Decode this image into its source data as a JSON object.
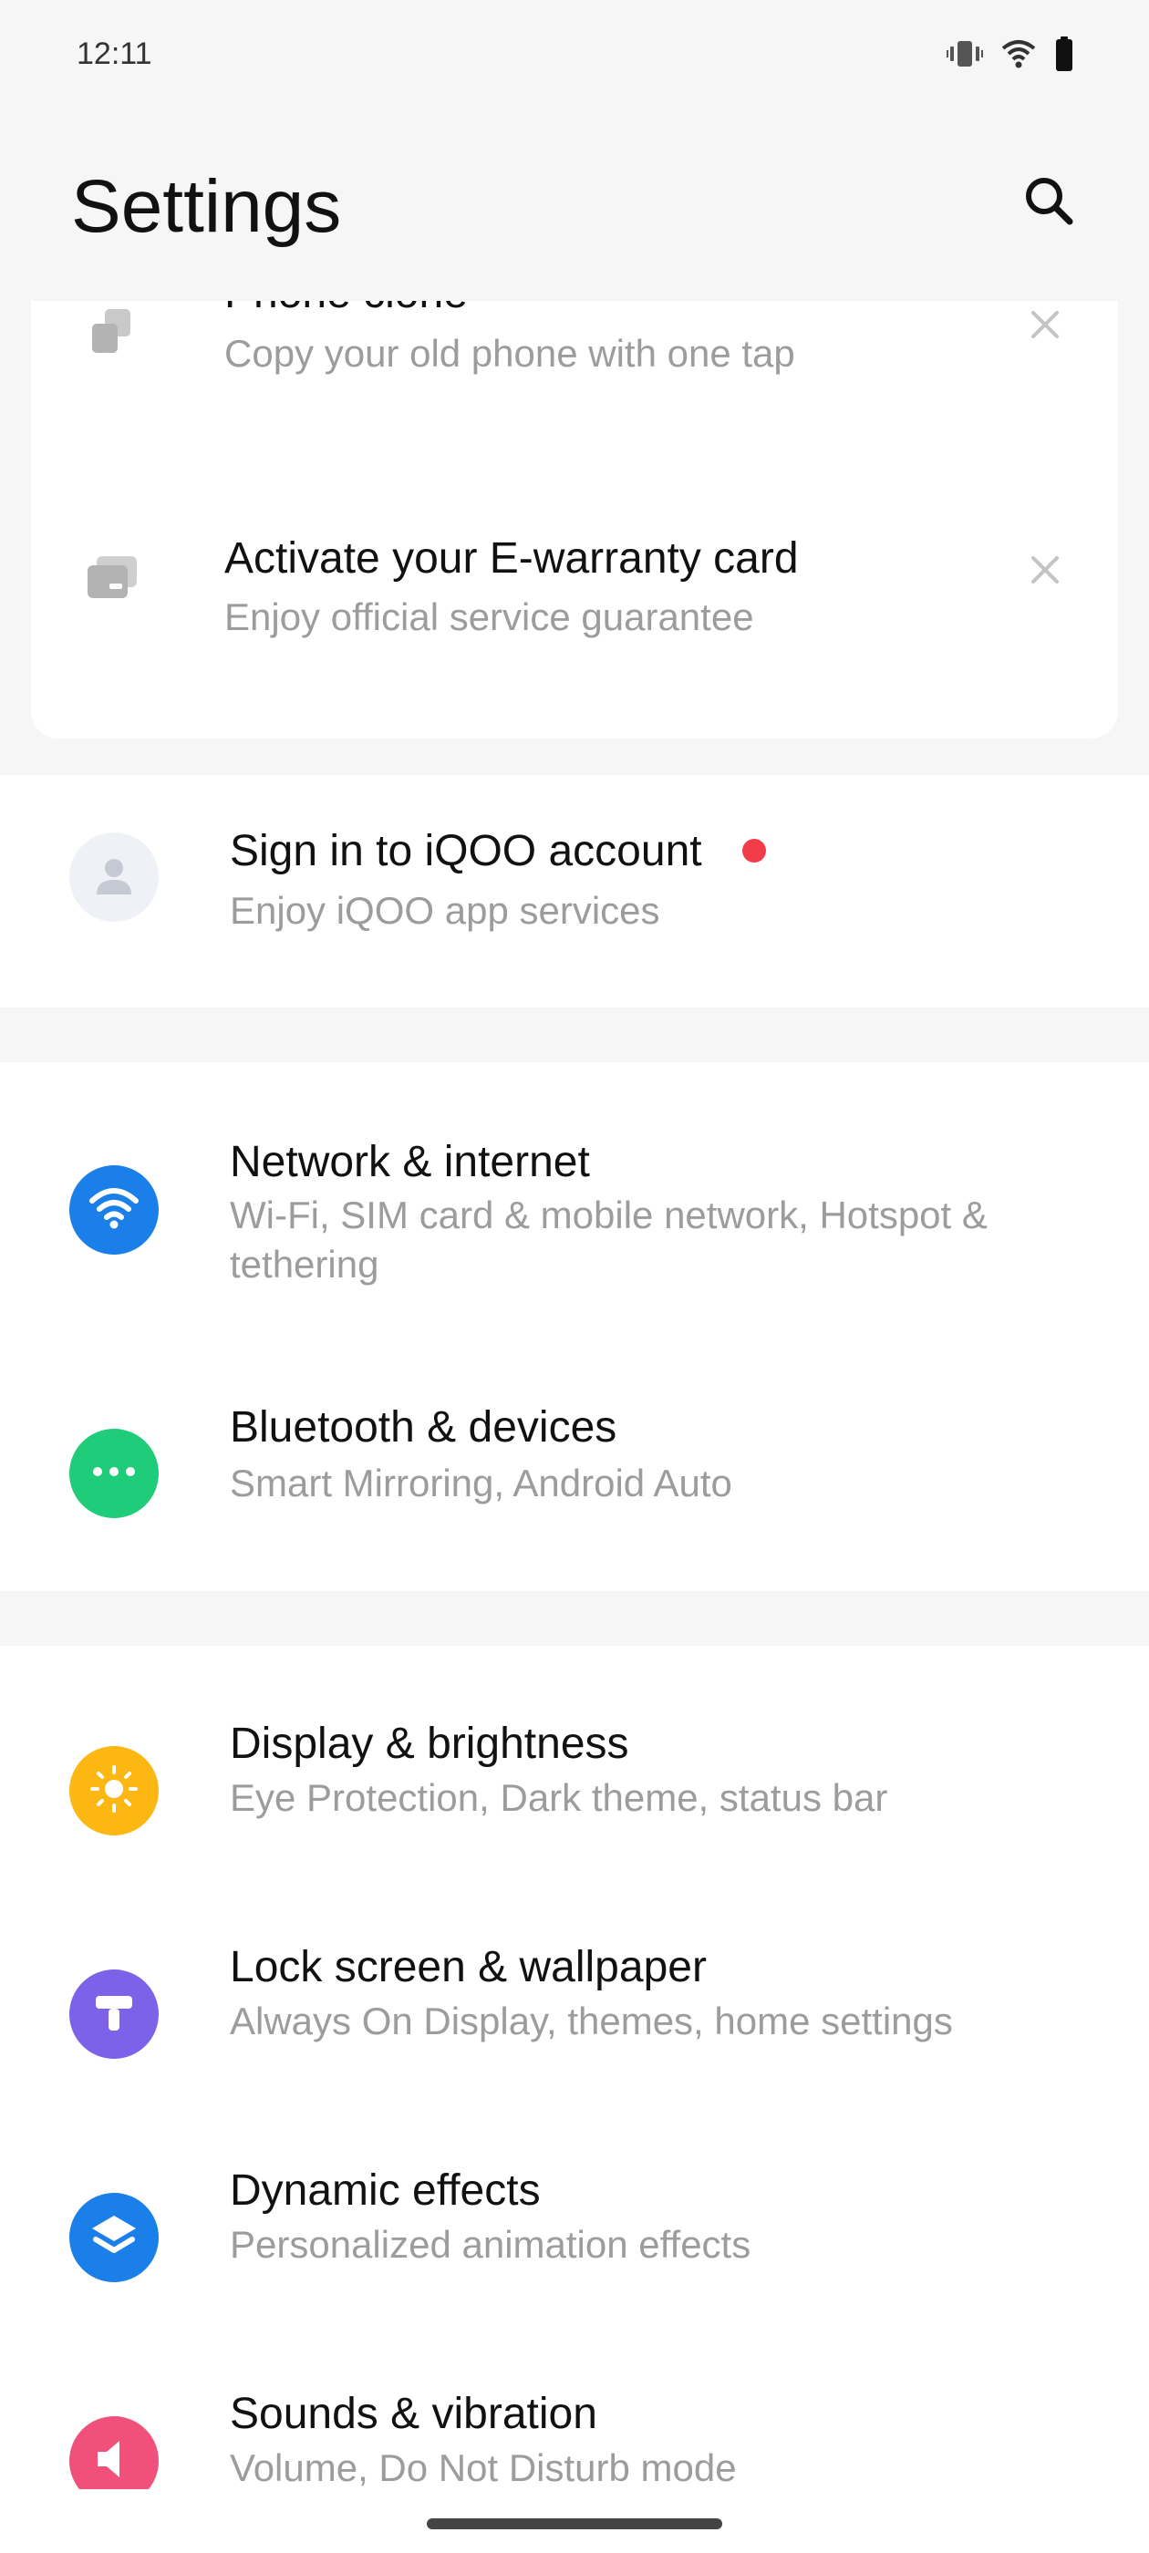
{
  "status_bar": {
    "time": "12:11",
    "icons": [
      "vibrate-icon",
      "wifi-icon",
      "battery-icon"
    ]
  },
  "header": {
    "title": "Settings",
    "search_icon": "search-icon"
  },
  "suggestions": [
    {
      "title": "Phone clone",
      "subtitle": "Copy your old phone with one tap",
      "icon": "phone-clone-icon"
    },
    {
      "title": "Activate your E-warranty card",
      "subtitle": "Enjoy official service guarantee",
      "icon": "warranty-card-icon"
    }
  ],
  "account": {
    "title": "Sign in to iQOO account",
    "subtitle": "Enjoy iQOO app services",
    "badge_color": "#f23c4a"
  },
  "connectivity": [
    {
      "title": "Network & internet",
      "subtitle": "Wi-Fi, SIM card & mobile network, Hotspot & tethering",
      "icon": "wifi-icon",
      "color": "#1a7fe8"
    },
    {
      "title": "Bluetooth & devices",
      "subtitle": "Smart Mirroring, Android Auto",
      "icon": "more-dots-icon",
      "color": "#1fcc7a"
    }
  ],
  "personalization": [
    {
      "title": "Display & brightness",
      "subtitle": "Eye Protection, Dark theme, status bar",
      "icon": "sun-icon",
      "color": "#fcb713"
    },
    {
      "title": "Lock screen & wallpaper",
      "subtitle": "Always On Display, themes, home settings",
      "icon": "paint-roller-icon",
      "color": "#7b62e8"
    },
    {
      "title": "Dynamic effects",
      "subtitle": "Personalized animation effects",
      "icon": "layers-icon",
      "color": "#1a7fe8"
    },
    {
      "title": "Sounds & vibration",
      "subtitle": "Volume, Do Not Disturb mode",
      "icon": "speaker-icon",
      "color": "#f0507a"
    }
  ]
}
